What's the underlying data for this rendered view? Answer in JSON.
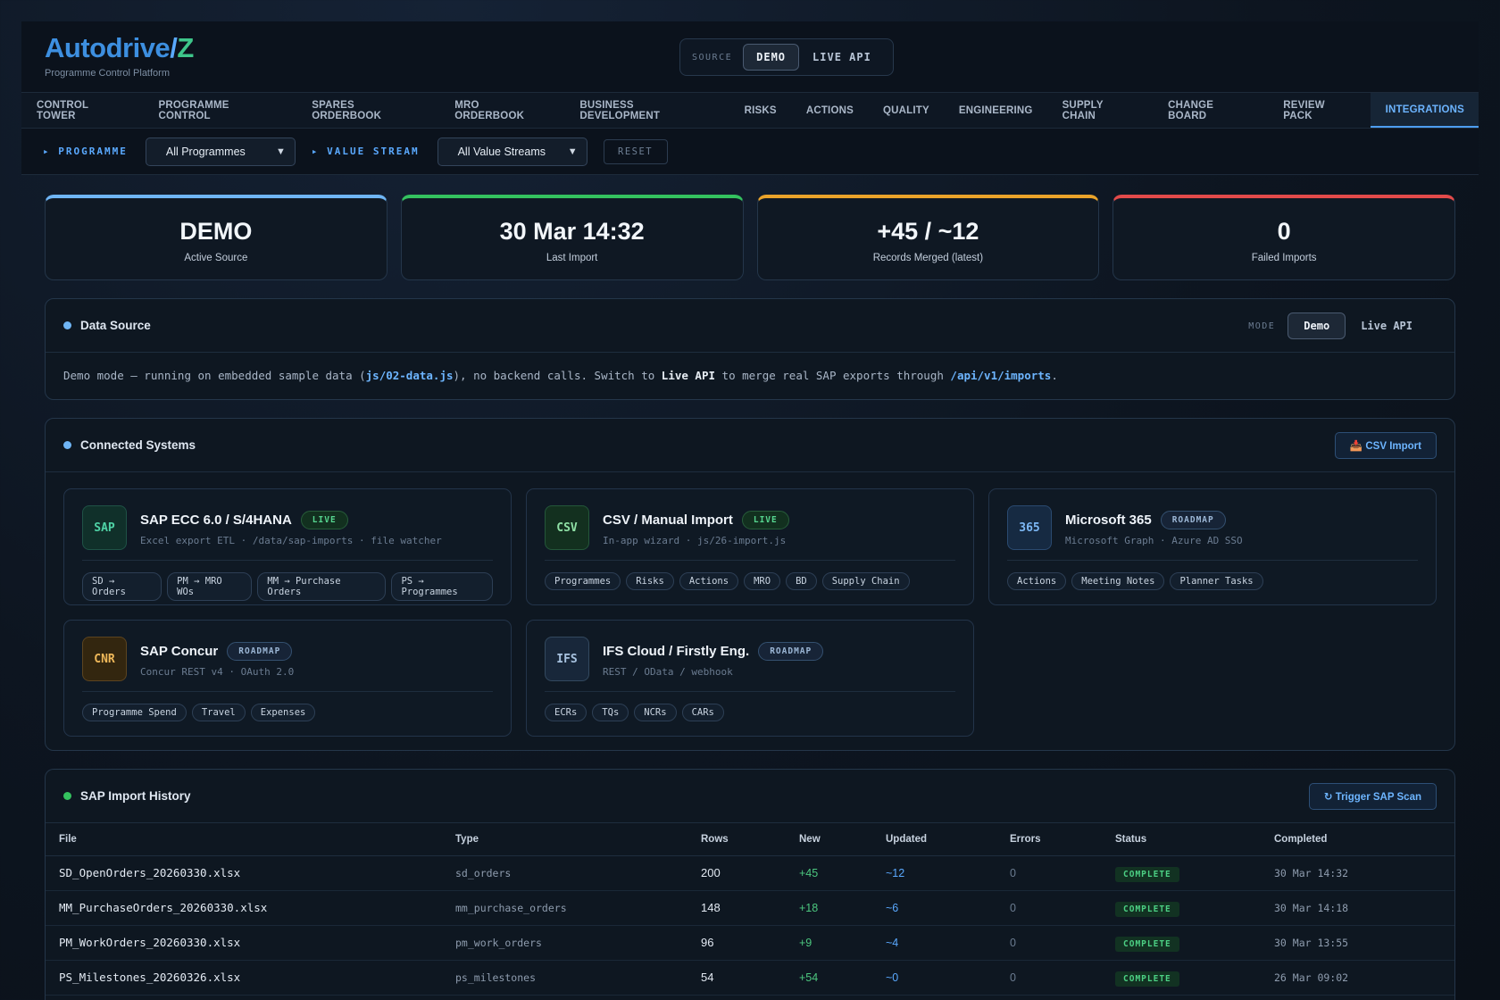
{
  "brand": {
    "logo_a": "Autodrive",
    "logo_slash": "/",
    "logo_z": "Z",
    "subtitle": "Programme Control Platform"
  },
  "source_toggle": {
    "label": "SOURCE",
    "demo": "DEMO",
    "live": "LIVE API"
  },
  "nav": [
    "CONTROL TOWER",
    "PROGRAMME CONTROL",
    "SPARES ORDERBOOK",
    "MRO ORDERBOOK",
    "BUSINESS DEVELOPMENT",
    "RISKS",
    "ACTIONS",
    "QUALITY",
    "ENGINEERING",
    "SUPPLY CHAIN",
    "CHANGE BOARD",
    "REVIEW PACK",
    "INTEGRATIONS"
  ],
  "filters": {
    "programme_label": "▸ PROGRAMME",
    "programme_value": "All Programmes",
    "stream_label": "▸ VALUE STREAM",
    "stream_value": "All Value Streams",
    "reset": "RESET"
  },
  "kpis": [
    {
      "value": "DEMO",
      "label": "Active Source",
      "color": "#6fb5f5"
    },
    {
      "value": "30 Mar 14:32",
      "label": "Last Import",
      "color": "#34c25f"
    },
    {
      "value": "+45 / ~12",
      "label": "Records Merged (latest)",
      "color": "#eaa32a"
    },
    {
      "value": "0",
      "label": "Failed Imports",
      "color": "#e24a4a"
    }
  ],
  "data_source": {
    "title": "Data Source",
    "mode_label": "MODE",
    "mode_demo": "Demo",
    "mode_live": "Live API",
    "text_1": "Demo mode — running on embedded sample data (",
    "code_1": "js/02-data.js",
    "text_2": "), no backend calls. Switch to ",
    "bold_1": "Live API",
    "text_3": " to merge real SAP exports through ",
    "code_2": "/api/v1/imports",
    "text_4": "."
  },
  "connected": {
    "title": "Connected Systems",
    "csv_button": "📥 CSV Import",
    "systems": [
      {
        "icon": "SAP",
        "name": "SAP ECC 6.0 / S/4HANA",
        "badge": "LIVE",
        "desc": "Excel export ETL · /data/sap-imports · file watcher",
        "chips": [
          "SD → Orders",
          "PM → MRO WOs",
          "MM → Purchase Orders",
          "PS → Programmes"
        ]
      },
      {
        "icon": "CSV",
        "name": "CSV / Manual Import",
        "badge": "LIVE",
        "desc": "In-app wizard · js/26-import.js",
        "chips": [
          "Programmes",
          "Risks",
          "Actions",
          "MRO",
          "BD",
          "Supply Chain"
        ]
      },
      {
        "icon": "365",
        "name": "Microsoft 365",
        "badge": "ROADMAP",
        "desc": "Microsoft Graph · Azure AD SSO",
        "chips": [
          "Actions",
          "Meeting Notes",
          "Planner Tasks"
        ]
      },
      {
        "icon": "CNR",
        "name": "SAP Concur",
        "badge": "ROADMAP",
        "desc": "Concur REST v4 · OAuth 2.0",
        "chips": [
          "Programme Spend",
          "Travel",
          "Expenses"
        ]
      },
      {
        "icon": "IFS",
        "name": "IFS Cloud / Firstly Eng.",
        "badge": "ROADMAP",
        "desc": "REST / OData / webhook",
        "chips": [
          "ECRs",
          "TQs",
          "NCRs",
          "CARs"
        ]
      }
    ]
  },
  "history": {
    "title": "SAP Import History",
    "scan_button": "↻ Trigger SAP Scan",
    "columns": [
      "File",
      "Type",
      "Rows",
      "New",
      "Updated",
      "Errors",
      "Status",
      "Completed"
    ],
    "rows": [
      [
        "SD_OpenOrders_20260330.xlsx",
        "sd_orders",
        "200",
        "+45",
        "~12",
        "0",
        "COMPLETE",
        "30 Mar 14:32"
      ],
      [
        "MM_PurchaseOrders_20260330.xlsx",
        "mm_purchase_orders",
        "148",
        "+18",
        "~6",
        "0",
        "COMPLETE",
        "30 Mar 14:18"
      ],
      [
        "PM_WorkOrders_20260330.xlsx",
        "pm_work_orders",
        "96",
        "+9",
        "~4",
        "0",
        "COMPLETE",
        "30 Mar 13:55"
      ],
      [
        "PS_Milestones_20260326.xlsx",
        "ps_milestones",
        "54",
        "+54",
        "~0",
        "0",
        "COMPLETE",
        "26 Mar 09:02"
      ]
    ]
  }
}
